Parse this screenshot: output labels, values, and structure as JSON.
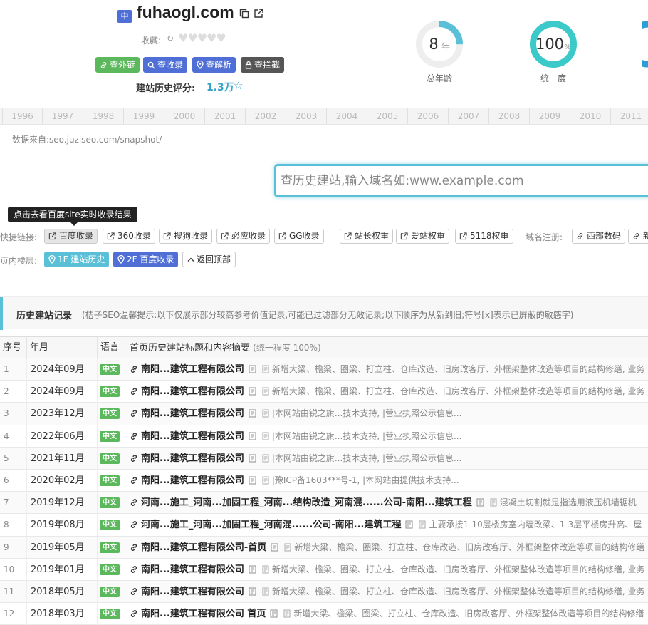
{
  "header": {
    "lang_badge": "中",
    "domain": "fuhaogl.com",
    "favorites_label": "收藏:",
    "favorites_arrow": "↻",
    "hearts": "♥♥♥♥♥",
    "buttons": [
      {
        "label": "查外链",
        "color": "#5cb85c",
        "icon": "link-icon"
      },
      {
        "label": "查收录",
        "color": "#4f6fd6",
        "icon": "search-icon"
      },
      {
        "label": "查解析",
        "color": "#4f6fd6",
        "icon": "location-pin-icon"
      },
      {
        "label": "查拦截",
        "color": "#555555",
        "icon": "lock-icon"
      }
    ],
    "score_label": "建站历史评分:",
    "score_value": "1.3万",
    "score_star": "☆"
  },
  "stats": [
    {
      "value": "8",
      "unit": "年",
      "label": "总年龄",
      "fraction": 0.25,
      "color": "#5ac0d8"
    },
    {
      "value": "100",
      "unit": "%",
      "label": "统一度",
      "fraction": 1.0,
      "color": "#3cc9c9"
    }
  ],
  "years": [
    "1996",
    "1997",
    "1998",
    "1999",
    "2000",
    "2001",
    "2002",
    "2003",
    "2004",
    "2005",
    "2006",
    "2007",
    "2008",
    "2009",
    "2010",
    "2011"
  ],
  "source_text": "数据来自:seo.juziseo.com/snapshot/",
  "search": {
    "placeholder": "查历史建站,输入域名如:www.example.com"
  },
  "tooltip": "点击去看百度site实时收录结果",
  "quick_links": {
    "label": "快捷链接:",
    "items": [
      "百度收录",
      "360收录",
      "搜狗收录",
      "必应收录",
      "GG收录",
      "站长权重",
      "爱站权重",
      "5118权重"
    ],
    "register_label": "域名注册:",
    "register_items": [
      "西部数码",
      "新"
    ]
  },
  "floors": {
    "label": "页内楼层:",
    "items": [
      "1F 建站历史",
      "2F 百度收录",
      "返回顶部"
    ]
  },
  "section": {
    "title": "历史建站记录",
    "note": "(桔子SEO温馨提示:以下仅展示部分较高参考价值记录,可能已过滤部分无效记录;以下顺序为从新到旧;符号[x]表示已屏蔽的敏感字)"
  },
  "table": {
    "headers": {
      "no": "序号",
      "date": "年月",
      "lang": "语言",
      "title": "首页历史建站标题和内容摘要",
      "title_note": "(统一程度 100%)"
    },
    "rows": [
      {
        "no": "1",
        "date": "2024年09月",
        "lang": "中文",
        "title": "南阳...建筑工程有限公司",
        "desc": "新增大梁、檐梁、圈梁、打立柱、仓库改造、旧房改客厅、外框架整体改造等项目的结构修缮, 业务"
      },
      {
        "no": "2",
        "date": "2024年09月",
        "lang": "中文",
        "title": "南阳...建筑工程有限公司",
        "desc": "新增大梁、檐梁、圈梁、打立柱、仓库改造、旧房改客厅、外框架整体改造等项目的结构修缮, 业务"
      },
      {
        "no": "3",
        "date": "2023年12月",
        "lang": "中文",
        "title": "南阳...建筑工程有限公司",
        "desc": "|本网站由锐之旗...技术支持, |营业执照公示信息..."
      },
      {
        "no": "4",
        "date": "2022年06月",
        "lang": "中文",
        "title": "南阳...建筑工程有限公司",
        "desc": "|本网站由锐之旗...技术支持, |营业执照公示信息..."
      },
      {
        "no": "5",
        "date": "2021年11月",
        "lang": "中文",
        "title": "南阳...建筑工程有限公司",
        "desc": "|本网站由锐之旗...技术支持, |营业执照公示信息..."
      },
      {
        "no": "6",
        "date": "2020年02月",
        "lang": "中文",
        "title": "南阳...建筑工程有限公司",
        "desc": "|豫ICP备1603***号-1, |本网站由提供技术支持..."
      },
      {
        "no": "7",
        "date": "2019年12月",
        "lang": "中文",
        "title": "河南...施工_河南...加固工程_河南...结构改造_河南混......公司-南阳...建筑工程",
        "desc": "混凝土切割就是指选用液压机墙锯机"
      },
      {
        "no": "8",
        "date": "2019年08月",
        "lang": "中文",
        "title": "河南...施工_河南...加固工程_河南混......公司-南阳...建筑工程",
        "desc": "主要承接1-10层楼房室内墙改梁、1-3层平楼房升高、屋"
      },
      {
        "no": "9",
        "date": "2019年05月",
        "lang": "中文",
        "title": "南阳...建筑工程有限公司-首页",
        "desc": "新增大梁、檐梁、圈梁、打立柱、仓库改造、旧房改客厅、外框架整体改造等项目的结构修缮"
      },
      {
        "no": "10",
        "date": "2019年01月",
        "lang": "中文",
        "title": "南阳...建筑工程有限公司",
        "desc": "新增大梁、檐梁、圈梁、打立柱、仓库改造、旧房改客厅、外框架整体改造等项目的结构修缮, 业务"
      },
      {
        "no": "11",
        "date": "2018年05月",
        "lang": "中文",
        "title": "南阳...建筑工程有限公司",
        "desc": "新增大梁、檐梁、圈梁、打立柱、仓库改造、旧房改客厅、外框架整体改造等项目的结构修缮, 业务"
      },
      {
        "no": "12",
        "date": "2018年03月",
        "lang": "中文",
        "title": "南阳...建筑工程有限公司 首页",
        "desc": "新增大梁、檐梁、圈梁、打立柱、仓库改造、旧房改客厅、外框架整体改造等项目的结构修缮"
      }
    ]
  }
}
